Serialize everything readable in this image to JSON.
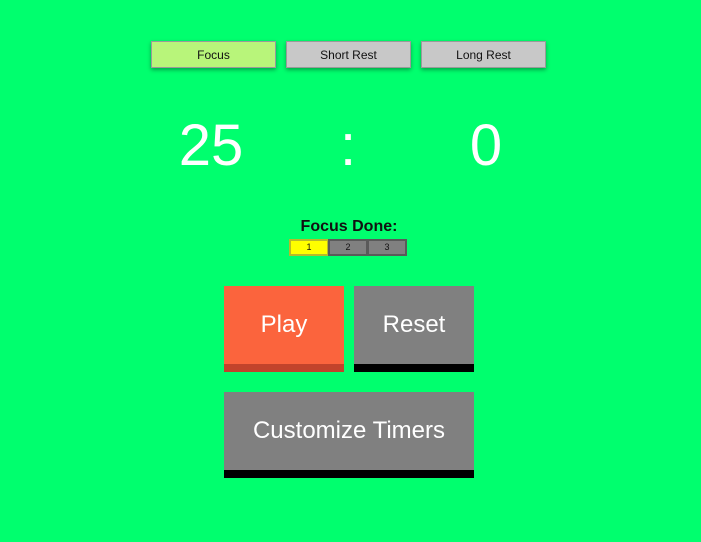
{
  "colors": {
    "background": "#00ff6e",
    "active_tab": "#b8f57a",
    "inactive_tab": "#c8c8c8",
    "play": "#fb643d",
    "neutral_button": "#808080",
    "focus_box_done": "#ffff00",
    "focus_box_pending": "#808080"
  },
  "mode_tabs": [
    {
      "label": "Focus",
      "active": true
    },
    {
      "label": "Short Rest",
      "active": false
    },
    {
      "label": "Long Rest",
      "active": false
    }
  ],
  "timer": {
    "minutes": "25",
    "separator": ":",
    "seconds": "0"
  },
  "focus_done": {
    "label": "Focus Done:",
    "boxes": [
      {
        "label": "1",
        "done": true
      },
      {
        "label": "2",
        "done": false
      },
      {
        "label": "3",
        "done": false
      }
    ]
  },
  "controls": {
    "play_label": "Play",
    "reset_label": "Reset",
    "customize_label": "Customize Timers"
  }
}
